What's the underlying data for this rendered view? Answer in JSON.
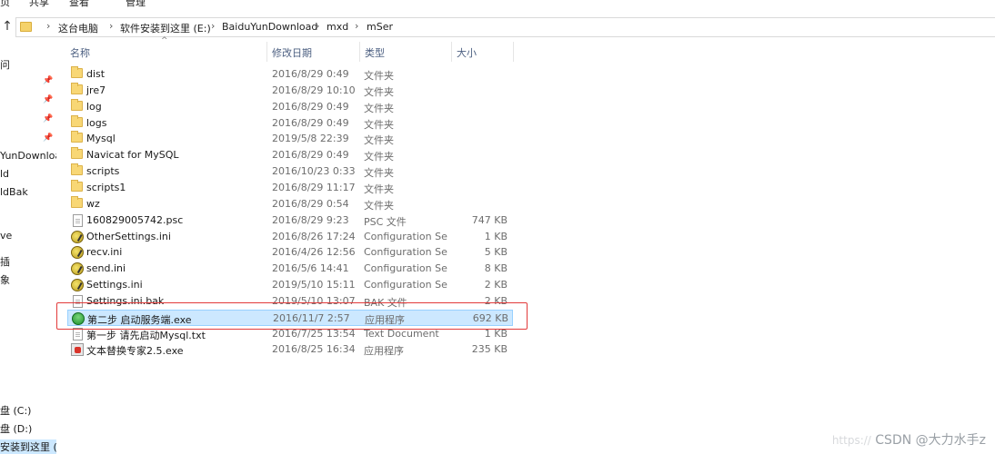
{
  "ribbon": {
    "tabs": [
      "页",
      "共享",
      "查看",
      "管理"
    ]
  },
  "address": {
    "crumbs": [
      "这台电脑",
      "软件安装到这里 (E:)",
      "BaiduYunDownload",
      "mxd",
      "mSer"
    ]
  },
  "nav": {
    "items": [
      "问",
      "YunDownloa",
      "ld",
      "ldBak",
      "ve",
      "插",
      "象",
      "盘 (C:)",
      "盘 (D:)",
      "安装到这里 (E:"
    ]
  },
  "columns": {
    "name": "名称",
    "date": "修改日期",
    "type": "类型",
    "size": "大小"
  },
  "files": [
    {
      "name": "dist",
      "date": "2016/8/29 0:49",
      "type": "文件夹",
      "size": "",
      "icon": "folder-icon"
    },
    {
      "name": "jre7",
      "date": "2016/8/29 10:10",
      "type": "文件夹",
      "size": "",
      "icon": "folder-icon"
    },
    {
      "name": "log",
      "date": "2016/8/29 0:49",
      "type": "文件夹",
      "size": "",
      "icon": "folder-icon"
    },
    {
      "name": "logs",
      "date": "2016/8/29 0:49",
      "type": "文件夹",
      "size": "",
      "icon": "folder-icon"
    },
    {
      "name": "Mysql",
      "date": "2019/5/8 22:39",
      "type": "文件夹",
      "size": "",
      "icon": "folder-icon"
    },
    {
      "name": "Navicat for MySQL",
      "date": "2016/8/29 0:49",
      "type": "文件夹",
      "size": "",
      "icon": "folder-icon"
    },
    {
      "name": "scripts",
      "date": "2016/10/23 0:33",
      "type": "文件夹",
      "size": "",
      "icon": "folder-icon"
    },
    {
      "name": "scripts1",
      "date": "2016/8/29 11:17",
      "type": "文件夹",
      "size": "",
      "icon": "folder-icon"
    },
    {
      "name": "wz",
      "date": "2016/8/29 0:54",
      "type": "文件夹",
      "size": "",
      "icon": "folder-icon"
    },
    {
      "name": "160829005742.psc",
      "date": "2016/8/29 9:23",
      "type": "PSC 文件",
      "size": "747 KB",
      "icon": "file-icon"
    },
    {
      "name": "OtherSettings.ini",
      "date": "2016/8/26 17:24",
      "type": "Configuration Se...",
      "size": "1 KB",
      "icon": "ini-icon"
    },
    {
      "name": "recv.ini",
      "date": "2016/4/26 12:56",
      "type": "Configuration Se...",
      "size": "5 KB",
      "icon": "ini-icon"
    },
    {
      "name": "send.ini",
      "date": "2016/5/6 14:41",
      "type": "Configuration Se...",
      "size": "8 KB",
      "icon": "ini-icon"
    },
    {
      "name": "Settings.ini",
      "date": "2019/5/10 15:11",
      "type": "Configuration Se...",
      "size": "2 KB",
      "icon": "ini-icon"
    },
    {
      "name": "Settings.ini.bak",
      "date": "2019/5/10 13:07",
      "type": "BAK 文件",
      "size": "2 KB",
      "icon": "file-icon"
    },
    {
      "name": "第二步 启动服务端.exe",
      "date": "2016/11/7 2:57",
      "type": "应用程序",
      "size": "692 KB",
      "icon": "exe-icon",
      "selected": true
    },
    {
      "name": "第一步 请先启动Mysql.txt",
      "date": "2016/7/25 13:54",
      "type": "Text Document",
      "size": "1 KB",
      "icon": "file-icon"
    },
    {
      "name": "文本替换专家2.5.exe",
      "date": "2016/8/25 16:34",
      "type": "应用程序",
      "size": "235 KB",
      "icon": "app-icon"
    }
  ],
  "watermark": {
    "faint": "https://",
    "text": "CSDN @大力水手z"
  },
  "colors": {
    "selection": "#cce8ff",
    "highlight_box": "#e23a3a",
    "header_text": "#4d6082"
  }
}
